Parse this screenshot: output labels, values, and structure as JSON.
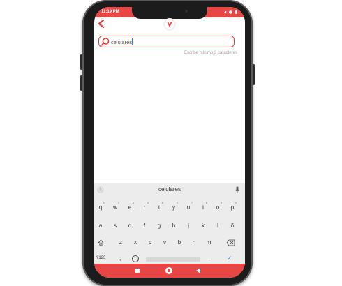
{
  "status_bar": {
    "time": "11:19 PM",
    "icons": "◂ ◉ ▮"
  },
  "header": {
    "back_icon": "chevron-left-icon",
    "logo_icon": "brand-logo-icon"
  },
  "search": {
    "value": "celulares",
    "hint": "Escribe mínimo 3 caracteres",
    "border_color": "#e23b3b"
  },
  "keyboard": {
    "suggestion": "celulares",
    "row1": [
      "q",
      "w",
      "e",
      "r",
      "t",
      "y",
      "u",
      "i",
      "o",
      "p"
    ],
    "row1_digits": [
      "1",
      "2",
      "3",
      "4",
      "5",
      "6",
      "7",
      "8",
      "9",
      "0"
    ],
    "row2": [
      "a",
      "s",
      "d",
      "f",
      "g",
      "h",
      "j",
      "k",
      "l",
      "ñ"
    ],
    "row3": [
      "z",
      "x",
      "c",
      "v",
      "b",
      "n",
      "m"
    ],
    "num_label": "?123",
    "comma": ",",
    "dot": ".",
    "enter": "✓"
  },
  "nav_bar": {
    "color": "#e84545"
  }
}
